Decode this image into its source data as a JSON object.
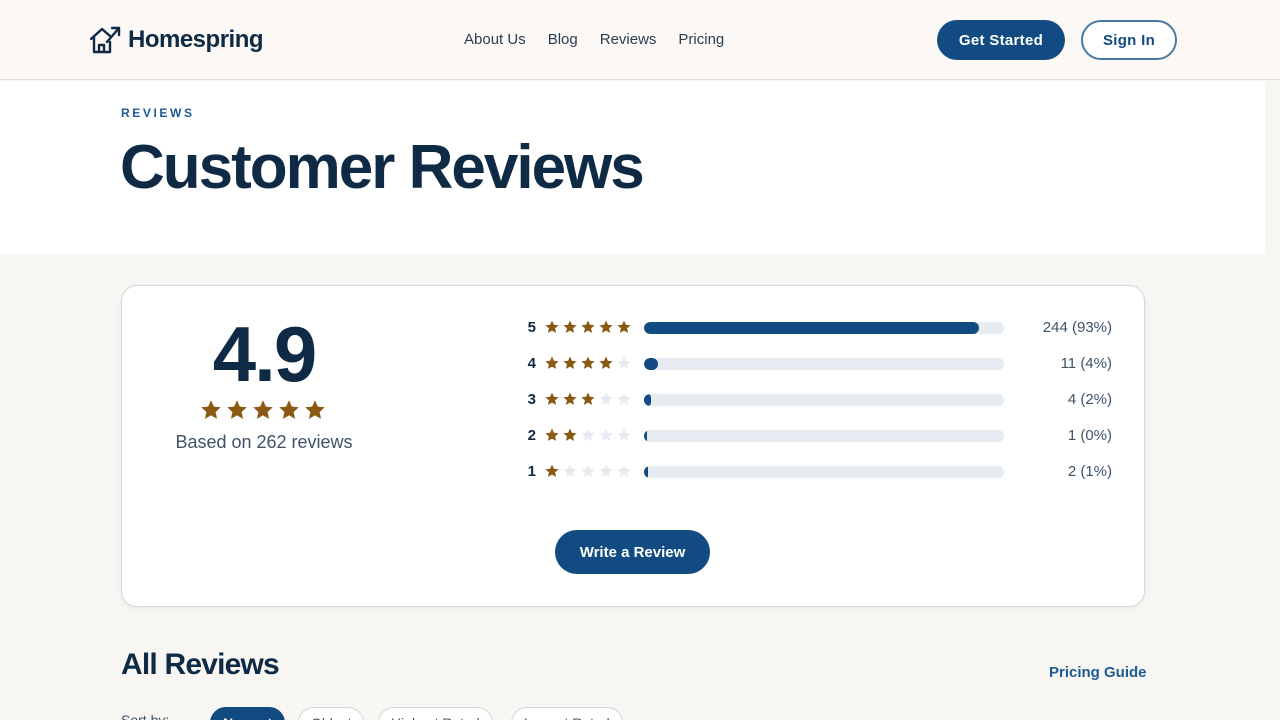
{
  "header": {
    "brand": "Homespring",
    "nav": [
      "About Us",
      "Blog",
      "Reviews",
      "Pricing"
    ],
    "get_started": "Get Started",
    "sign_in": "Sign In"
  },
  "hero": {
    "eyebrow": "REVIEWS",
    "title": "Customer Reviews"
  },
  "summary": {
    "average": "4.9",
    "average_stars": 5,
    "based_on": "Based on 262 reviews",
    "distribution": [
      {
        "stars": "5",
        "filled": 5,
        "count": "244 (93%)",
        "fraction": 0.93
      },
      {
        "stars": "4",
        "filled": 4,
        "count": "11 (4%)",
        "fraction": 0.04
      },
      {
        "stars": "3",
        "filled": 3,
        "count": "4 (2%)",
        "fraction": 0.02
      },
      {
        "stars": "2",
        "filled": 2,
        "count": "1 (0%)",
        "fraction": 0.0
      },
      {
        "stars": "1",
        "filled": 1,
        "count": "2 (1%)",
        "fraction": 0.01
      }
    ],
    "write_review": "Write a Review"
  },
  "reviews": {
    "title": "All Reviews",
    "pricing_guide": "Pricing Guide",
    "sort_label": "Sort by:",
    "sort_options": [
      "Newest",
      "Oldest",
      "Highest Rated",
      "Lowest Rated"
    ],
    "active_sort": "Newest"
  },
  "colors": {
    "primary": "#114b82",
    "star": "#8a5a14",
    "star_empty": "#e6ebf1",
    "text_dark": "#0f2a44"
  }
}
